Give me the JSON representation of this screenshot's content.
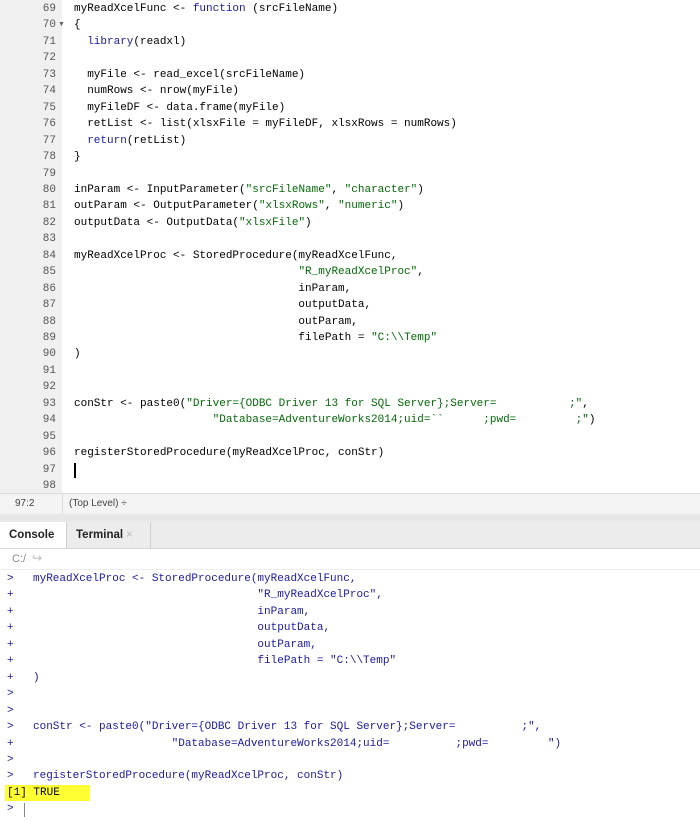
{
  "editor": {
    "lines": [
      {
        "n": "69",
        "seg": [
          [
            "myReadXcelFunc <- ",
            ""
          ],
          [
            "function",
            ""
          ],
          [
            " (srcFileName)",
            ""
          ]
        ],
        "kw": [
          1
        ]
      },
      {
        "n": "70",
        "fold": true,
        "seg": [
          [
            "{",
            ""
          ]
        ]
      },
      {
        "n": "71",
        "seg": [
          [
            "  ",
            ""
          ],
          [
            "library",
            "kw"
          ],
          [
            "(readxl)",
            ""
          ]
        ]
      },
      {
        "n": "72",
        "seg": []
      },
      {
        "n": "73",
        "seg": [
          [
            "  myFile <- read_excel(srcFileName)",
            ""
          ]
        ]
      },
      {
        "n": "74",
        "seg": [
          [
            "  numRows <- nrow(myFile)",
            ""
          ]
        ]
      },
      {
        "n": "75",
        "seg": [
          [
            "  myFileDF <- data.frame(myFile)",
            ""
          ]
        ]
      },
      {
        "n": "76",
        "seg": [
          [
            "  retList <- list(xlsxFile = myFileDF, xlsxRows = numRows)",
            ""
          ]
        ]
      },
      {
        "n": "77",
        "seg": [
          [
            "  ",
            ""
          ],
          [
            "return",
            "kw"
          ],
          [
            "(retList)",
            ""
          ]
        ]
      },
      {
        "n": "78",
        "seg": [
          [
            "}",
            ""
          ]
        ]
      },
      {
        "n": "79",
        "seg": []
      },
      {
        "n": "80",
        "seg": [
          [
            "inParam <- InputParameter(",
            ""
          ],
          [
            "\"srcFileName\"",
            "str"
          ],
          [
            ", ",
            ""
          ],
          [
            "\"character\"",
            "str"
          ],
          [
            ")",
            ""
          ]
        ]
      },
      {
        "n": "81",
        "seg": [
          [
            "outParam <- OutputParameter(",
            ""
          ],
          [
            "\"xlsxRows\"",
            "str"
          ],
          [
            ", ",
            ""
          ],
          [
            "\"numeric\"",
            "str"
          ],
          [
            ")",
            ""
          ]
        ]
      },
      {
        "n": "82",
        "seg": [
          [
            "outputData <- OutputData(",
            ""
          ],
          [
            "\"xlsxFile\"",
            "str"
          ],
          [
            ")",
            ""
          ]
        ]
      },
      {
        "n": "83",
        "seg": []
      },
      {
        "n": "84",
        "seg": [
          [
            "myReadXcelProc <- StoredProcedure(myReadXcelFunc,",
            ""
          ]
        ]
      },
      {
        "n": "85",
        "seg": [
          [
            "                                  ",
            ""
          ],
          [
            "\"R_myReadXcelProc\"",
            "str"
          ],
          [
            ",",
            ""
          ]
        ]
      },
      {
        "n": "86",
        "seg": [
          [
            "                                  inParam,",
            ""
          ]
        ]
      },
      {
        "n": "87",
        "seg": [
          [
            "                                  outputData,",
            ""
          ]
        ]
      },
      {
        "n": "88",
        "seg": [
          [
            "                                  outParam,",
            ""
          ]
        ]
      },
      {
        "n": "89",
        "seg": [
          [
            "                                  filePath = ",
            ""
          ],
          [
            "\"C:\\\\Temp\"",
            "str"
          ]
        ]
      },
      {
        "n": "90",
        "seg": [
          [
            ")",
            ""
          ]
        ]
      },
      {
        "n": "91",
        "seg": []
      },
      {
        "n": "92",
        "seg": []
      },
      {
        "n": "93",
        "seg": [
          [
            "conStr <- paste0(",
            ""
          ],
          [
            "\"Driver={ODBC Driver 13 for SQL Server};Server=           ;\"",
            "str"
          ],
          [
            ",",
            ""
          ]
        ]
      },
      {
        "n": "94",
        "seg": [
          [
            "                     ",
            ""
          ],
          [
            "\"Database=AdventureWorks2014;uid=``      ;pwd=         ;\"",
            "str"
          ],
          [
            ")",
            ""
          ]
        ]
      },
      {
        "n": "95",
        "seg": []
      },
      {
        "n": "96",
        "seg": [
          [
            "registerStoredProcedure(myReadXcelProc, conStr)",
            ""
          ]
        ]
      },
      {
        "n": "97",
        "cursor": true,
        "seg": []
      },
      {
        "n": "98",
        "seg": []
      }
    ]
  },
  "status": {
    "position": "97:2",
    "scope": "(Top Level) ÷"
  },
  "tabs": {
    "console": "Console",
    "terminal": "Terminal",
    "close": "×"
  },
  "console_toolbar": {
    "path": "C:/",
    "arrow": "↪"
  },
  "console": {
    "lines": [
      {
        "p": ">",
        "t": "myReadXcelProc <- StoredProcedure(myReadXcelFunc,"
      },
      {
        "p": "+",
        "t": "                                  \"R_myReadXcelProc\","
      },
      {
        "p": "+",
        "t": "                                  inParam,"
      },
      {
        "p": "+",
        "t": "                                  outputData,"
      },
      {
        "p": "+",
        "t": "                                  outParam,"
      },
      {
        "p": "+",
        "t": "                                  filePath = \"C:\\\\Temp\""
      },
      {
        "p": "+",
        "t": ")"
      },
      {
        "p": ">",
        "t": ""
      },
      {
        "p": ">",
        "t": ""
      },
      {
        "p": ">",
        "t": "conStr <- paste0(\"Driver={ODBC Driver 13 for SQL Server};Server=          ;\","
      },
      {
        "p": "+",
        "t": "                     \"Database=AdventureWorks2014;uid=          ;pwd=         \")"
      },
      {
        "p": ">",
        "t": ""
      },
      {
        "p": ">",
        "t": "registerStoredProcedure(myReadXcelProc, conStr)"
      }
    ],
    "output": "[1] TRUE",
    "final_prompt": ">"
  }
}
